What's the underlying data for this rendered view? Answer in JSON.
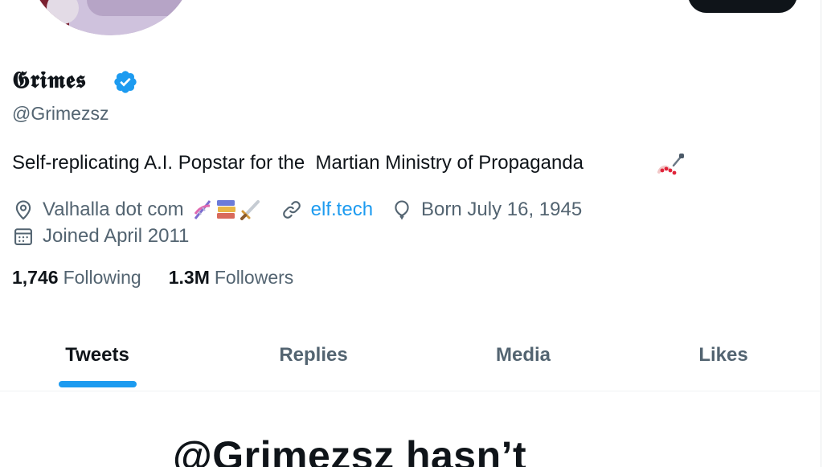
{
  "profile": {
    "display_name": "𝕲𝖗𝖎𝖒𝖊𝖘",
    "handle": "@Grimezsz",
    "bio": "Self-replicating A.I. Popstar for the  Martian Ministry of Propaganda"
  },
  "meta": {
    "location": "Valhalla dot com",
    "website": "elf.tech",
    "birthday": "Born July 16, 1945",
    "joined": "Joined April 2011"
  },
  "stats": {
    "following_count": "1,746",
    "following_label": "Following",
    "followers_count": "1.3M",
    "followers_label": "Followers"
  },
  "tabs": [
    {
      "label": "Tweets",
      "active": true
    },
    {
      "label": "Replies",
      "active": false
    },
    {
      "label": "Media",
      "active": false
    },
    {
      "label": "Likes",
      "active": false
    }
  ],
  "empty_state": {
    "heading": "@Grimezsz hasn’t"
  },
  "colors": {
    "accent": "#1d9bf0",
    "text_primary": "#0f1419",
    "text_secondary": "#536471"
  },
  "icons": {
    "verified": "verified-badge-icon",
    "location": "location-pin-icon",
    "link": "link-icon",
    "birthday": "balloon-icon",
    "joined": "calendar-icon"
  }
}
